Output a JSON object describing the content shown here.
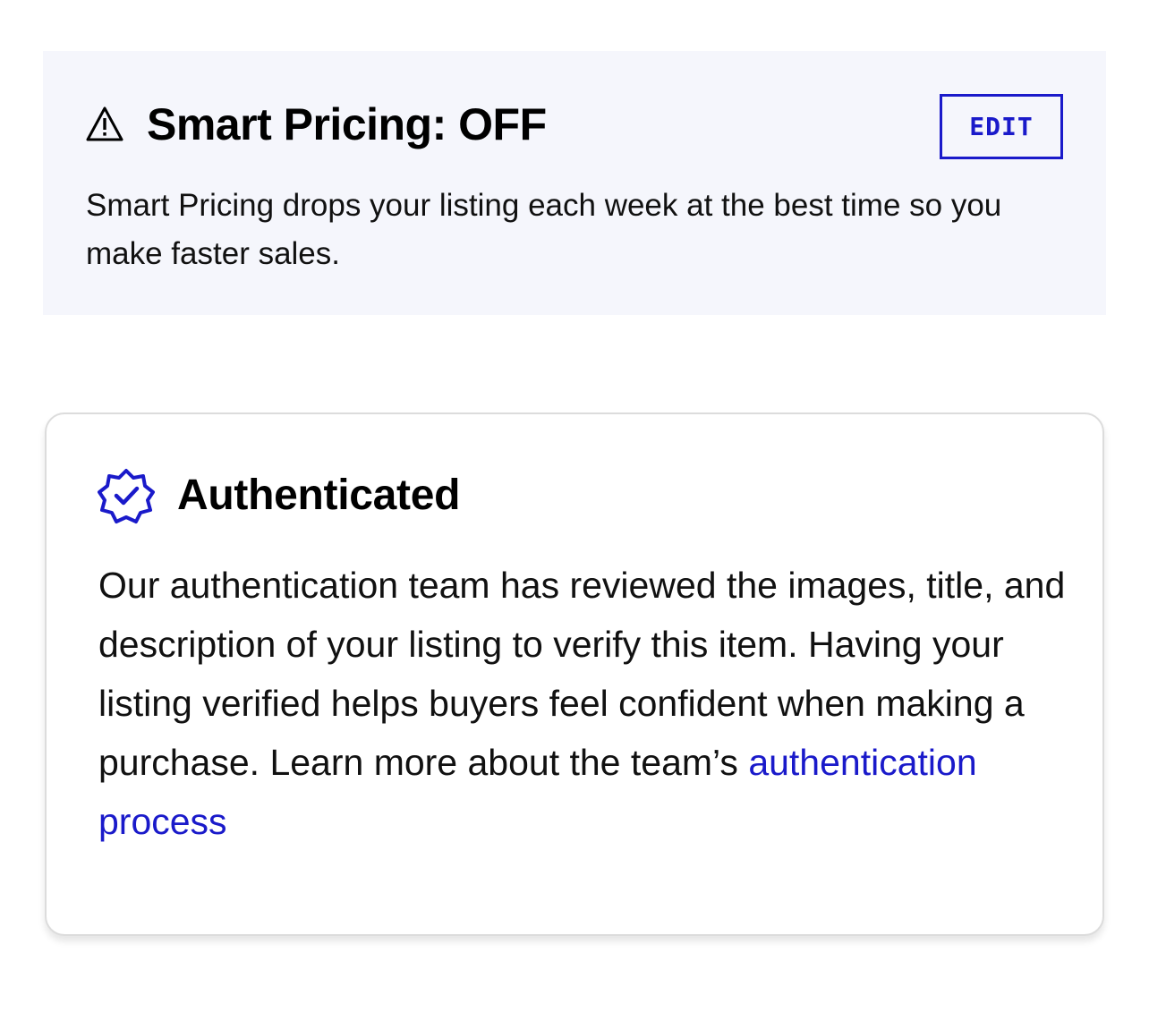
{
  "smart_pricing": {
    "icon": "warning-icon",
    "title": "Smart Pricing: OFF",
    "edit_label": "EDIT",
    "description": "Smart Pricing drops your listing each week at the best time so you make faster sales.",
    "background_color": "#f5f6fc",
    "accent_color": "#1a1aca"
  },
  "authenticated": {
    "icon": "verified-badge-icon",
    "title": "Authenticated",
    "body": "Our authentication team has reviewed the images, title, and description of your listing to verify this item. Having your listing verified helps buyers feel confident when making a purchase. Learn more about the team’s",
    "link_text": "authentication process",
    "link_color": "#1a1aca"
  }
}
